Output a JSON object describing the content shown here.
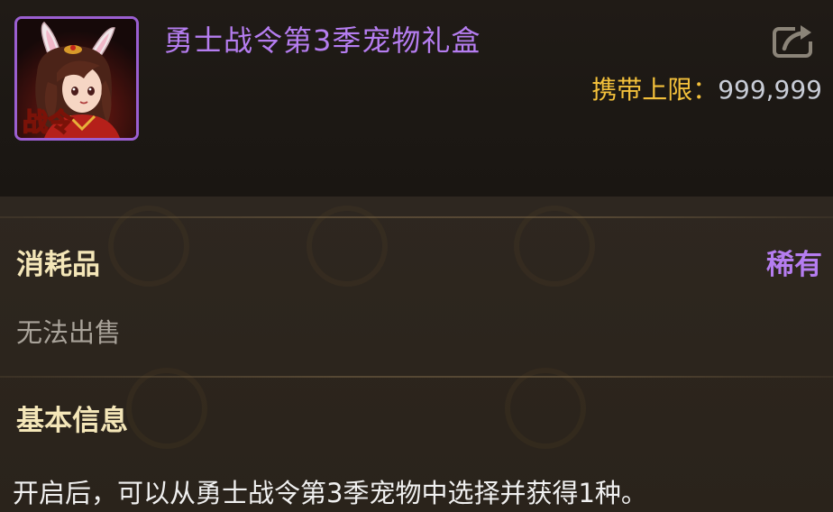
{
  "item": {
    "name": "勇士战令第3季宠物礼盒",
    "icon": "bunny-ear-girl-portrait",
    "icon_badge": "战令",
    "name_color": "#b57df0"
  },
  "carry": {
    "label": "携带上限：",
    "value": "999,999"
  },
  "share": {
    "icon": "share-icon"
  },
  "details": {
    "category": "消耗品",
    "rarity": "稀有",
    "rarity_color": "#b57df0",
    "tradeable": "无法出售",
    "section_title": "基本信息",
    "description": "开启后，可以从勇士战令第3季宠物中选择并获得1种。"
  }
}
